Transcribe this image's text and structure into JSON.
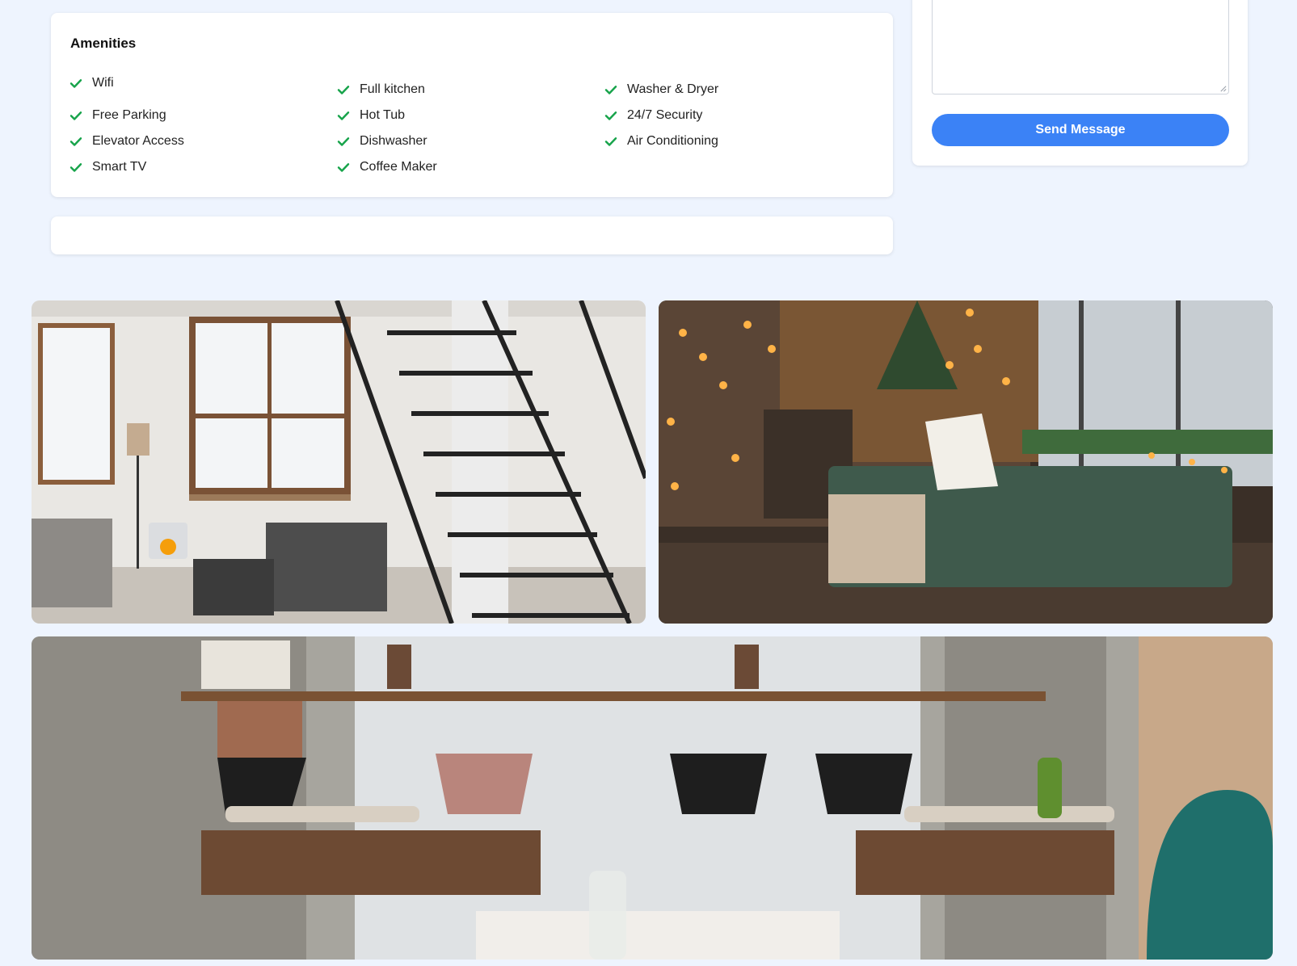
{
  "amenities": {
    "title": "Amenities",
    "items": [
      {
        "label": "Wifi",
        "icon": "check-icon"
      },
      {
        "label": "Full kitchen",
        "icon": "check-icon"
      },
      {
        "label": "Washer & Dryer",
        "icon": "check-icon"
      },
      {
        "label": "Free Parking",
        "icon": "check-icon"
      },
      {
        "label": "Hot Tub",
        "icon": "check-icon"
      },
      {
        "label": "24/7 Security",
        "icon": "check-icon"
      },
      {
        "label": "Elevator Access",
        "icon": "check-icon"
      },
      {
        "label": "Dishwasher",
        "icon": "check-icon"
      },
      {
        "label": "Air Conditioning",
        "icon": "check-icon"
      },
      {
        "label": "Smart TV",
        "icon": "check-icon"
      },
      {
        "label": "Coffee Maker",
        "icon": "check-icon"
      }
    ]
  },
  "contact": {
    "message_value": "",
    "send_label": "Send Message"
  },
  "gallery": {
    "photos": [
      {
        "subject": "loft living room with staircase"
      },
      {
        "subject": "cozy bedroom with string lights"
      },
      {
        "subject": "cafe seating area"
      }
    ]
  },
  "colors": {
    "page_background": "#eef4fe",
    "accent": "#3b82f6",
    "check": "#16a34a",
    "card": "#ffffff"
  }
}
